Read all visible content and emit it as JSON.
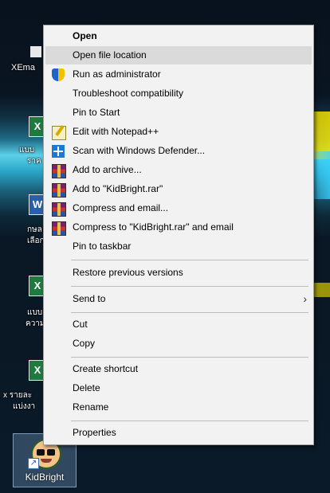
{
  "desktop": {
    "icons": [
      {
        "name": "xemail-icon",
        "label": "XEma"
      },
      {
        "name": "excel-file-icon",
        "label_1": "แบบ",
        "label_2": "ราค"
      },
      {
        "name": "word-file-icon",
        "label_1": "กษล",
        "label_2": "เลือก"
      },
      {
        "name": "excel-file-icon-2",
        "label_1": "แบบ",
        "label_2": "ความ"
      },
      {
        "name": "excel-file-icon-3",
        "label_1": "x รายละ",
        "label_2": "แบ่งงา"
      }
    ],
    "selected": {
      "label": "KidBright"
    }
  },
  "menu": {
    "open": "Open",
    "open_file_location": "Open file location",
    "run_as_admin": "Run as administrator",
    "troubleshoot": "Troubleshoot compatibility",
    "pin_start": "Pin to Start",
    "edit_notepad": "Edit with Notepad++",
    "scan_defender": "Scan with Windows Defender...",
    "add_archive": "Add to archive...",
    "add_rar": "Add to \"KidBright.rar\"",
    "compress_email": "Compress and email...",
    "compress_rar_email": "Compress to \"KidBright.rar\" and email",
    "pin_taskbar": "Pin to taskbar",
    "restore_versions": "Restore previous versions",
    "send_to": "Send to",
    "cut": "Cut",
    "copy": "Copy",
    "create_shortcut": "Create shortcut",
    "delete": "Delete",
    "rename": "Rename",
    "properties": "Properties"
  },
  "colors": {
    "menu_bg": "#f2f2f2",
    "hover": "#dadada",
    "separator": "#bcbcbc"
  }
}
